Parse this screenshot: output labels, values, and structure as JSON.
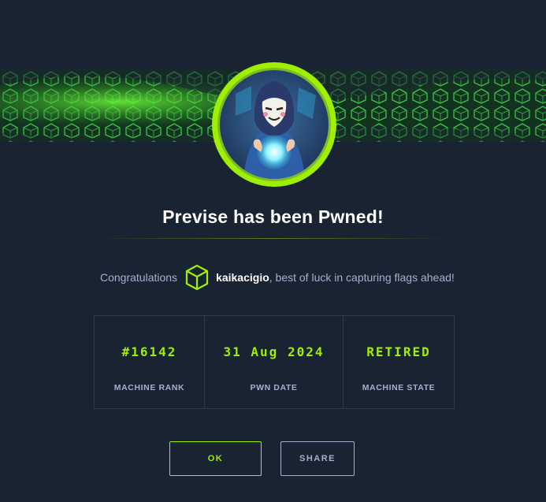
{
  "modal": {
    "title": "Previse has been Pwned!",
    "congrats": {
      "prefix": "Congratulations",
      "username": "kaikacigio",
      "suffix": ", best of luck in capturing flags ahead!",
      "icon": "htb-cube-icon"
    },
    "stats": [
      {
        "value": "#16142",
        "label": "MACHINE RANK"
      },
      {
        "value": "31 Aug 2024",
        "label": "PWN DATE"
      },
      {
        "value": "RETIRED",
        "label": "MACHINE STATE"
      }
    ],
    "buttons": {
      "ok": "OK",
      "share": "SHARE"
    }
  },
  "colors": {
    "background": "#1a2332",
    "accent": "#9fef00",
    "muted_text": "#a4b1cd",
    "border": "#2c3a4e"
  }
}
